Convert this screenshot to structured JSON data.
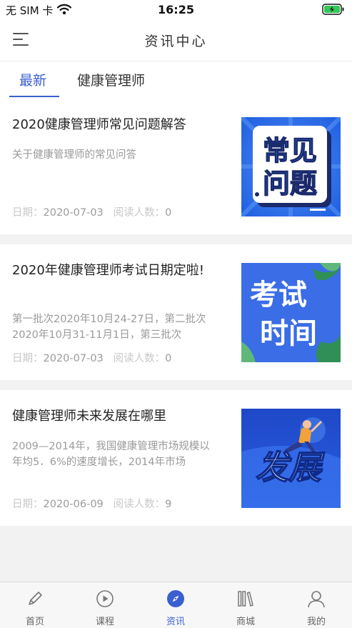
{
  "status": {
    "carrier": "无 SIM 卡",
    "time": "16:25"
  },
  "nav": {
    "title": "资讯中心"
  },
  "tabs": [
    {
      "label": "最新",
      "active": true
    },
    {
      "label": "健康管理师",
      "active": false
    }
  ],
  "articles": [
    {
      "title": "2020健康管理师常见问题解答",
      "desc": "关于健康管理师的常见问答",
      "date_label": "日期：",
      "date": "2020-07-03",
      "reads_label": "阅读人数：",
      "reads": "0",
      "thumb_text": [
        "常见",
        "问题"
      ]
    },
    {
      "title": "2020年健康管理师考试日期定啦!",
      "desc": "第一批次2020年10月24-27日，第二批次2020年10月31-11月1日，第三批次",
      "date_label": "日期：",
      "date": "2020-07-03",
      "reads_label": "阅读人数：",
      "reads": "0",
      "thumb_text": [
        "考试",
        "时间"
      ]
    },
    {
      "title": "健康管理师未来发展在哪里",
      "desc": "2009—2014年，我国健康管理市场规模以年均5．6%的速度增长，2014年市场",
      "date_label": "日期：",
      "date": "2020-06-09",
      "reads_label": "阅读人数：",
      "reads": "9",
      "thumb_text": [
        "发展"
      ]
    }
  ],
  "bottom_tabs": [
    {
      "label": "首页",
      "icon": "pencil-icon",
      "active": false
    },
    {
      "label": "课程",
      "icon": "play-circle-icon",
      "active": false
    },
    {
      "label": "资讯",
      "icon": "compass-icon",
      "active": true
    },
    {
      "label": "商城",
      "icon": "books-icon",
      "active": false
    },
    {
      "label": "我的",
      "icon": "user-icon",
      "active": false
    }
  ],
  "colors": {
    "accent": "#3a5fd0",
    "thumb_blue": "#2d6ee8",
    "page_bg": "#f2f2f3"
  }
}
